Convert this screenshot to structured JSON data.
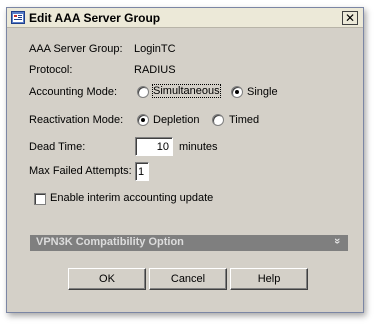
{
  "window": {
    "title": "Edit AAA Server Group",
    "close_glyph": "✕",
    "icon": "app-window-icon"
  },
  "fields": {
    "server_group": {
      "label": "AAA Server Group:",
      "value": "LoginTC"
    },
    "protocol": {
      "label": "Protocol:",
      "value": "RADIUS"
    },
    "accounting_mode": {
      "label": "Accounting Mode:",
      "options": [
        {
          "label": "Simultaneous",
          "checked": false
        },
        {
          "label": "Single",
          "checked": true
        }
      ]
    },
    "reactivation_mode": {
      "label": "Reactivation Mode:",
      "options": [
        {
          "label": "Depletion",
          "checked": true
        },
        {
          "label": "Timed",
          "checked": false
        }
      ]
    },
    "dead_time": {
      "label": "Dead Time:",
      "value": "10",
      "unit": "minutes"
    },
    "max_failed": {
      "label": "Max Failed Attempts:",
      "value": "1"
    },
    "interim_update": {
      "label": "Enable interim accounting update",
      "checked": false
    }
  },
  "vpn3k": {
    "label": "VPN3K Compatibility Option",
    "icon": "double-chevron-down-icon",
    "glyph": "»"
  },
  "buttons": {
    "ok": "OK",
    "cancel": "Cancel",
    "help": "Help"
  }
}
